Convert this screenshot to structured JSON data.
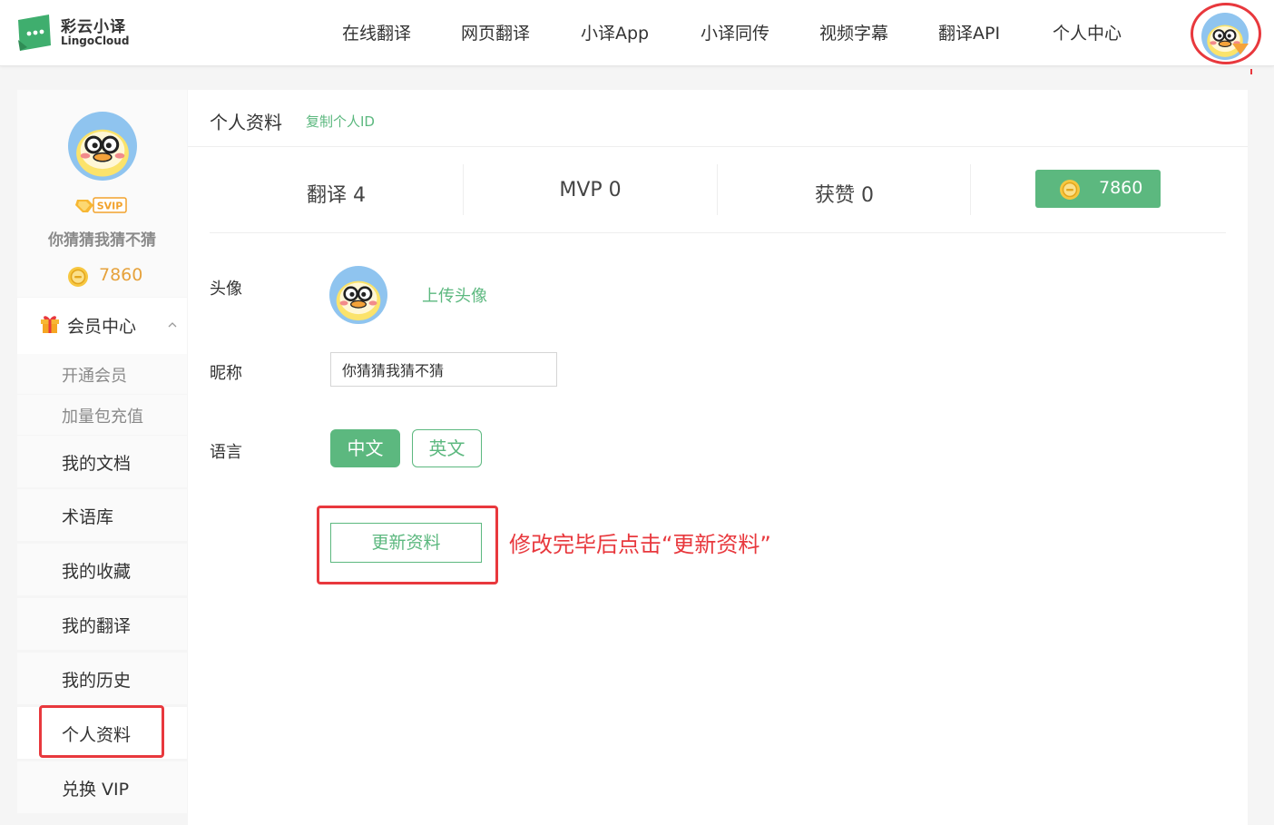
{
  "header": {
    "logo_cn": "彩云小译",
    "logo_en": "LingoCloud",
    "nav": [
      {
        "label": "在线翻译"
      },
      {
        "label": "网页翻译"
      },
      {
        "label": "小译App"
      },
      {
        "label": "小译同传"
      },
      {
        "label": "视频字幕"
      },
      {
        "label": "翻译API"
      },
      {
        "label": "个人中心"
      }
    ]
  },
  "sidebar": {
    "badge": "SVIP",
    "username": "你猜猜我猜不猜",
    "coins": "7860",
    "member_group": "会员中心",
    "sub_items": [
      {
        "label": "开通会员"
      },
      {
        "label": "加量包充值"
      }
    ],
    "items": [
      {
        "label": "我的文档"
      },
      {
        "label": "术语库"
      },
      {
        "label": "我的收藏"
      },
      {
        "label": "我的翻译"
      },
      {
        "label": "我的历史"
      },
      {
        "label": "个人资料"
      },
      {
        "label": "兑换 VIP"
      }
    ]
  },
  "main": {
    "title": "个人资料",
    "copy_id": "复制个人ID",
    "stats": [
      {
        "label": "翻译 4"
      },
      {
        "label": "MVP 0"
      },
      {
        "label": "获赞 0"
      }
    ],
    "coins": "7860",
    "avatar_label": "头像",
    "upload_label": "上传头像",
    "nickname_label": "昵称",
    "nickname_value": "你猜猜我猜不猜",
    "language_label": "语言",
    "lang_cn": "中文",
    "lang_en": "英文",
    "update_label": "更新资料",
    "annotation": "修改完毕后点击“更新资料”"
  },
  "colors": {
    "accent": "#5cb87f",
    "highlight": "#e8383d",
    "coin": "#e6a23c"
  }
}
